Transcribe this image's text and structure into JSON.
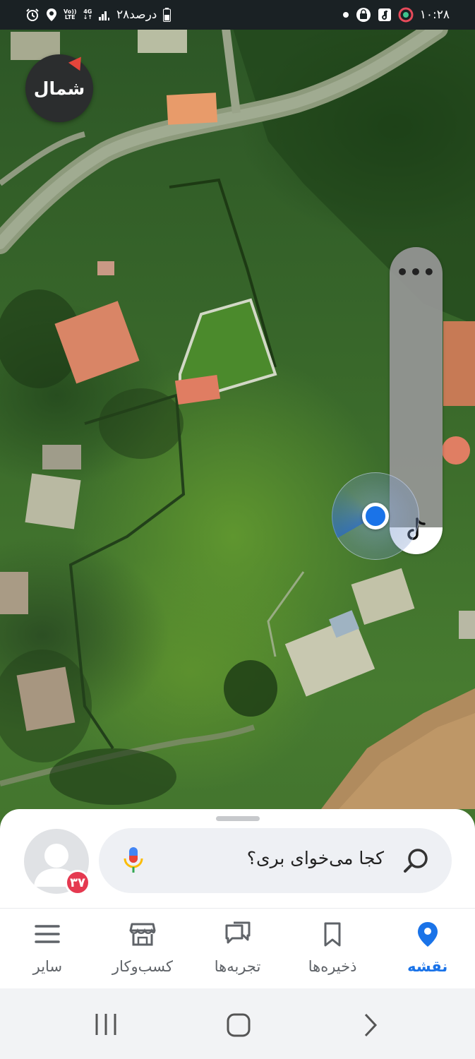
{
  "status_bar": {
    "time": "۱۰:۲۸",
    "battery_text": "۲۸درصد",
    "network_label_top": "4G",
    "network_label_volte": "Vo))",
    "network_label_lte": "LTE"
  },
  "map": {
    "compass_label": "شمال",
    "more_options_label": "•••"
  },
  "search": {
    "placeholder": "کجا می‌خوای بری؟"
  },
  "profile": {
    "notification_count": "۳۷"
  },
  "bottom_nav": {
    "items": [
      {
        "label": "نقشه",
        "icon": "map-pin-icon",
        "active": true
      },
      {
        "label": "ذخیره‌ها",
        "icon": "bookmark-icon",
        "active": false
      },
      {
        "label": "تجربه‌ها",
        "icon": "chat-bubbles-icon",
        "active": false
      },
      {
        "label": "کسب‌وکار",
        "icon": "store-icon",
        "active": false
      },
      {
        "label": "سایر",
        "icon": "menu-icon",
        "active": false
      }
    ]
  },
  "colors": {
    "accent": "#1a73e8",
    "badge": "#e53950",
    "compass_bg": "#2b2d2e",
    "status_bar_bg": "#1a2124"
  }
}
